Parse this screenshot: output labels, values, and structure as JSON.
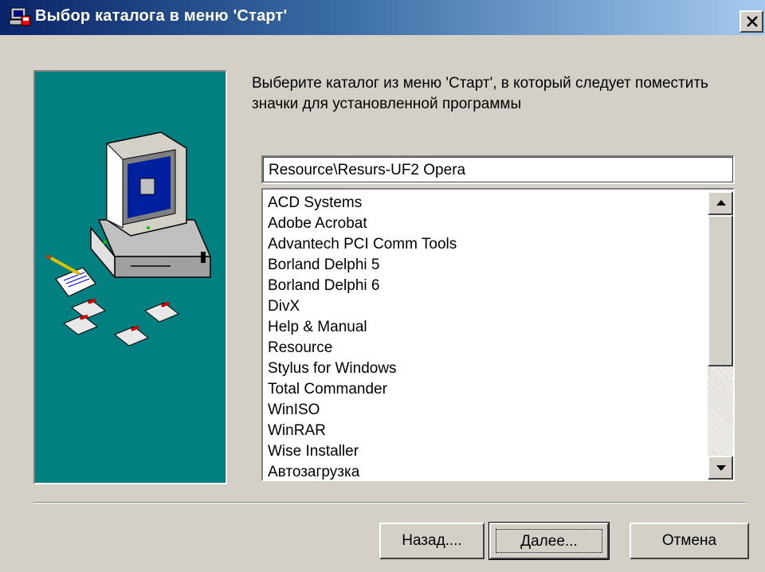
{
  "window": {
    "title": "Выбор каталога в меню 'Старт'",
    "icon": "setup-icon"
  },
  "instruction": "Выберите каталог из меню 'Старт', в который следует поместить значки для установленной программы",
  "folder_field": {
    "value": "Resource\\Resurs-UF2 Opera"
  },
  "folder_list": {
    "items": [
      "ACD Systems",
      "Adobe Acrobat",
      "Advantech PCI Comm Tools",
      "Borland Delphi 5",
      "Borland Delphi 6",
      "DivX",
      "Help & Manual",
      "Resource",
      "Stylus for Windows",
      "Total Commander",
      "WinISO",
      "WinRAR",
      "Wise Installer",
      "Автозагрузка"
    ]
  },
  "buttons": {
    "back": "Назад....",
    "next": "Далее...",
    "cancel": "Отмена"
  },
  "colors": {
    "title_bar_start": "#0a246a",
    "title_bar_end": "#a6caf0",
    "dialog_bg": "#d4d0c8",
    "art_panel_bg": "#008080"
  }
}
